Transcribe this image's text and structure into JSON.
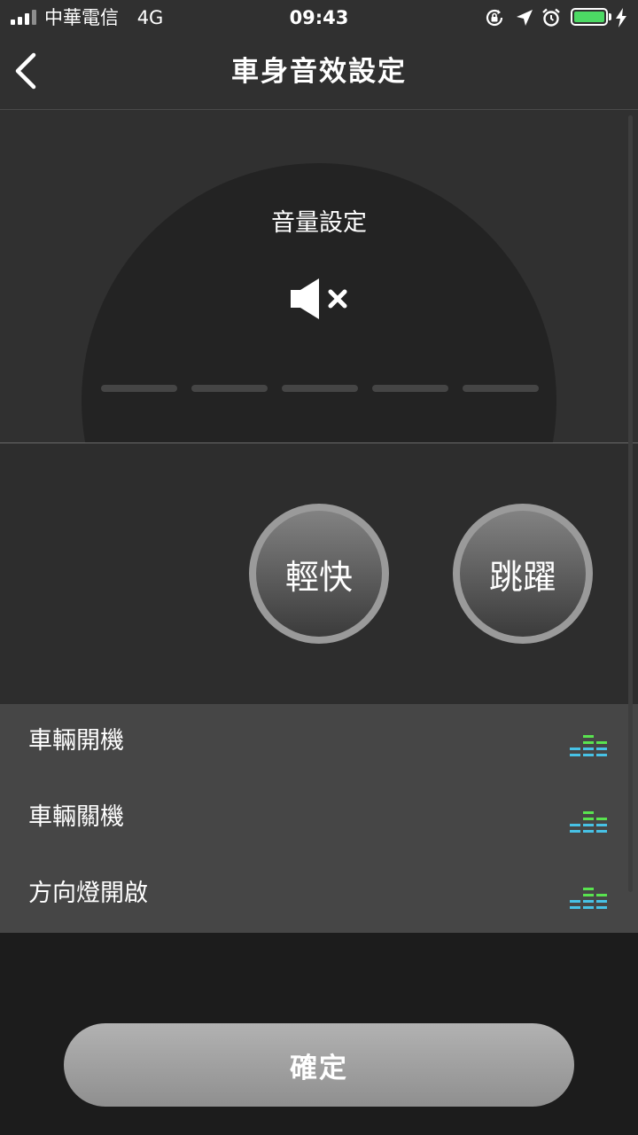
{
  "status_bar": {
    "carrier": "中華電信",
    "network": "4G",
    "time": "09:43",
    "battery_level": 1.0,
    "battery_color": "#4cd964"
  },
  "header": {
    "title": "車身音效設定",
    "back_icon": "chevron-left-icon"
  },
  "volume": {
    "label": "音量設定",
    "icon": "speaker-muted-icon",
    "level": 0,
    "segments": 5
  },
  "styles": [
    {
      "label": "輕快"
    },
    {
      "label": "跳躍"
    }
  ],
  "sounds": [
    {
      "label": "車輛開機",
      "icon": "equalizer-icon"
    },
    {
      "label": "車輛關機",
      "icon": "equalizer-icon"
    },
    {
      "label": "方向燈開啟",
      "icon": "equalizer-icon"
    }
  ],
  "confirm_label": "確定",
  "colors": {
    "eq_green": "#59e34f",
    "eq_blue": "#47c2e6"
  }
}
